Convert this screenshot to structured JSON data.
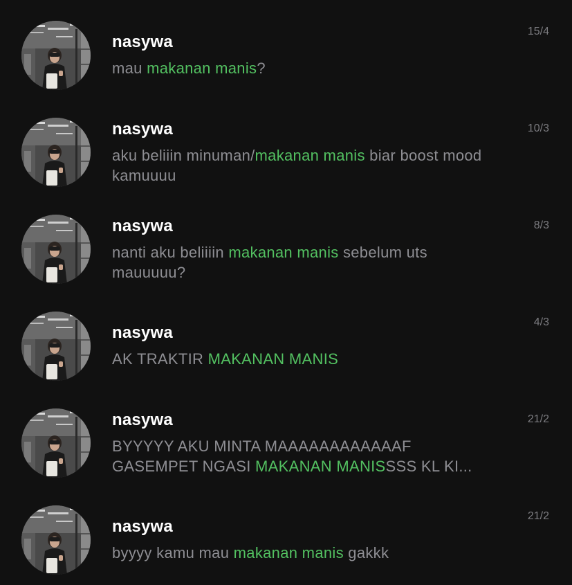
{
  "colors": {
    "background": "#111111",
    "name": "#ffffff",
    "snippet": "#8e8e93",
    "highlight": "#53c161",
    "date": "#7c7c80"
  },
  "search": {
    "highlight_term": "makanan manis"
  },
  "results": [
    {
      "name": "nasywa",
      "date": "15/4",
      "snippet": [
        {
          "text": "mau ",
          "hl": false
        },
        {
          "text": "makanan manis",
          "hl": true
        },
        {
          "text": "?",
          "hl": false
        }
      ]
    },
    {
      "name": "nasywa",
      "date": "10/3",
      "snippet": [
        {
          "text": "aku beliiin minuman/",
          "hl": false
        },
        {
          "text": "makanan manis",
          "hl": true
        },
        {
          "text": " biar boost mood kamuuuu",
          "hl": false
        }
      ]
    },
    {
      "name": "nasywa",
      "date": "8/3",
      "snippet": [
        {
          "text": "nanti aku beliiiin ",
          "hl": false
        },
        {
          "text": "makanan manis",
          "hl": true
        },
        {
          "text": " sebelum uts mauuuuu?",
          "hl": false
        }
      ]
    },
    {
      "name": "nasywa",
      "date": "4/3",
      "snippet": [
        {
          "text": "AK TRAKTIR ",
          "hl": false
        },
        {
          "text": "MAKANAN MANIS",
          "hl": true
        }
      ]
    },
    {
      "name": "nasywa",
      "date": "21/2",
      "snippet": [
        {
          "text": "BYYYYY AKU MINTA MAAAAAAAAAAAAF GASEMPET NGASI ",
          "hl": false
        },
        {
          "text": "MAKANAN MANIS",
          "hl": true
        },
        {
          "text": "SSS KL KI...",
          "hl": false
        }
      ]
    },
    {
      "name": "nasywa",
      "date": "21/2",
      "snippet": [
        {
          "text": "byyyy kamu mau ",
          "hl": false
        },
        {
          "text": "makanan manis",
          "hl": true
        },
        {
          "text": " gakkk",
          "hl": false
        }
      ]
    }
  ]
}
